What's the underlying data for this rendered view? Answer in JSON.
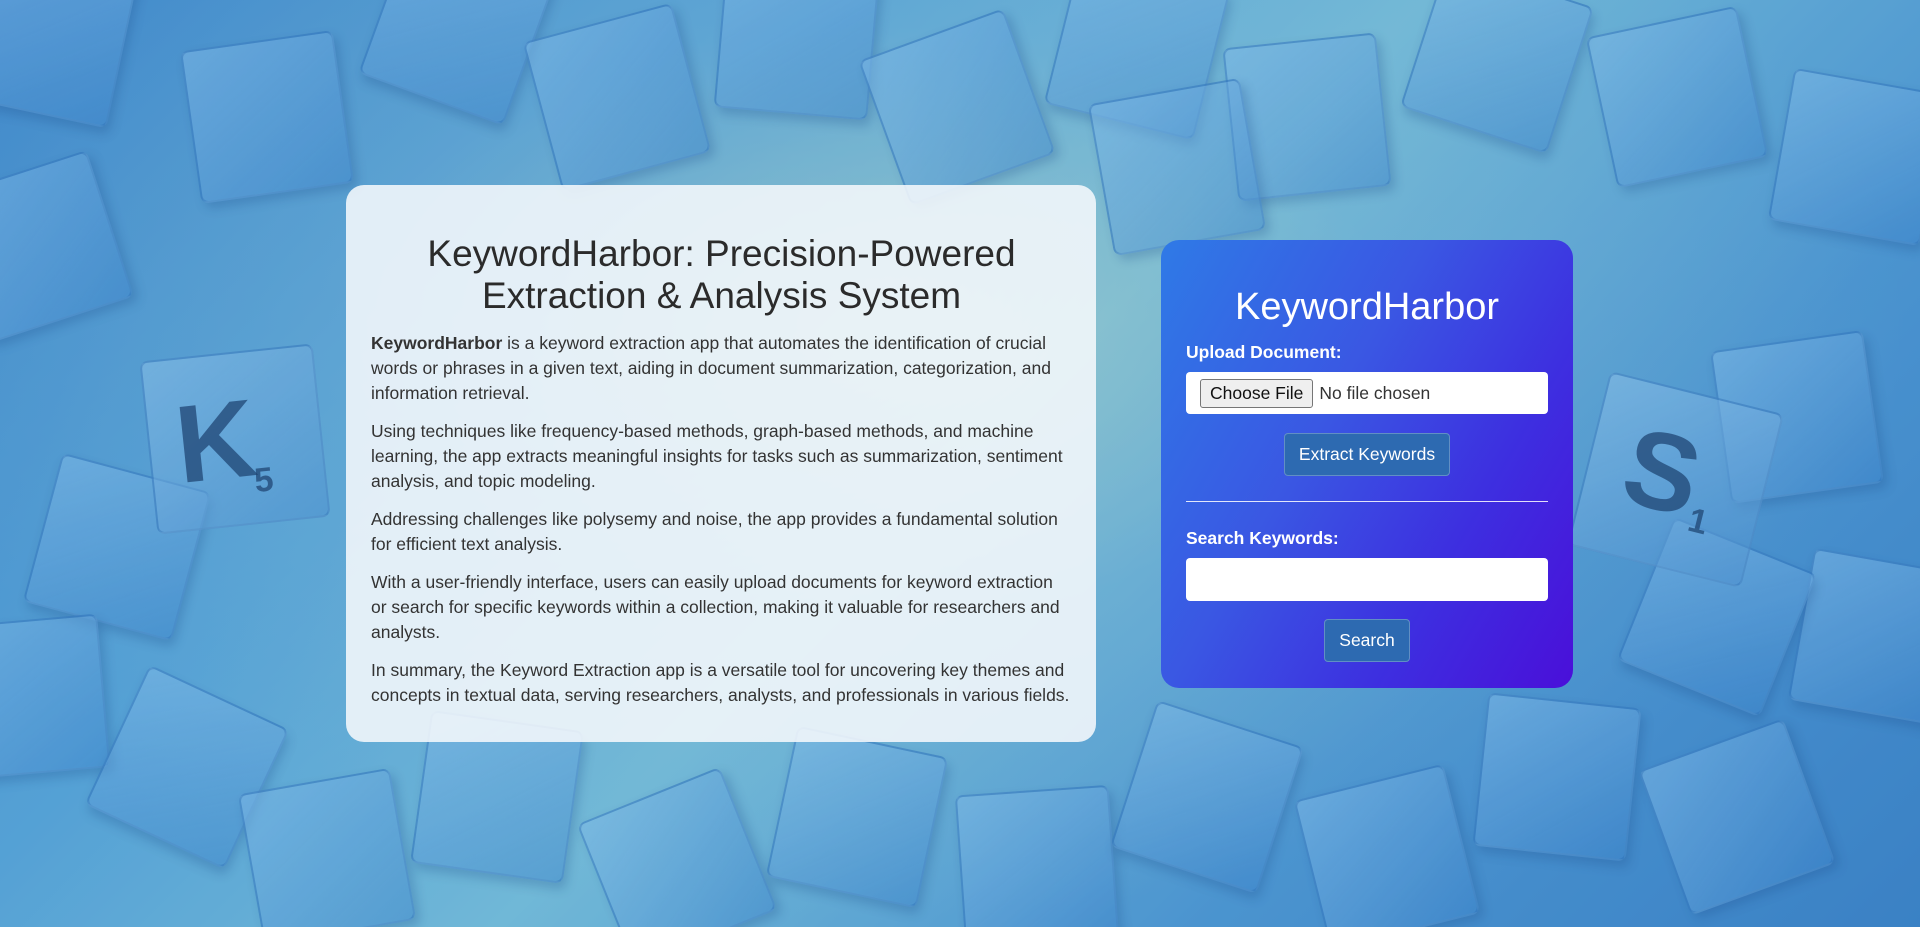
{
  "info": {
    "title": "KeywordHarbor: Precision-Powered Extraction & Analysis System",
    "intro_bold": "KeywordHarbor",
    "intro_rest": " is a keyword extraction app that automates the identification of crucial words or phrases in a given text, aiding in document summarization, categorization, and information retrieval.",
    "paragraphs": [
      "Using techniques like frequency-based methods, graph-based methods, and machine learning, the app extracts meaningful insights for tasks such as summarization, sentiment analysis, and topic modeling.",
      "Addressing challenges like polysemy and noise, the app provides a fundamental solution for efficient text analysis.",
      "With a user-friendly interface, users can easily upload documents for keyword extraction or search for specific keywords within a collection, making it valuable for researchers and analysts.",
      "In summary, the Keyword Extraction app is a versatile tool for uncovering key themes and concepts in textual data, serving researchers, analysts, and professionals in various fields."
    ]
  },
  "tool": {
    "title": "KeywordHarbor",
    "upload_label": "Upload Document:",
    "file_button": "Choose File",
    "file_status": "No file chosen",
    "extract_button": "Extract Keywords",
    "search_label": "Search Keywords:",
    "search_value": "",
    "search_button": "Search"
  },
  "background_tiles": {
    "letters": [
      {
        "big": "K",
        "small": "5"
      },
      {
        "big": "S",
        "small": "1"
      }
    ]
  },
  "colors": {
    "tool_card_start": "#2f7ae6",
    "tool_card_end": "#4a0fd9",
    "action_button": "#2d6ab1"
  }
}
